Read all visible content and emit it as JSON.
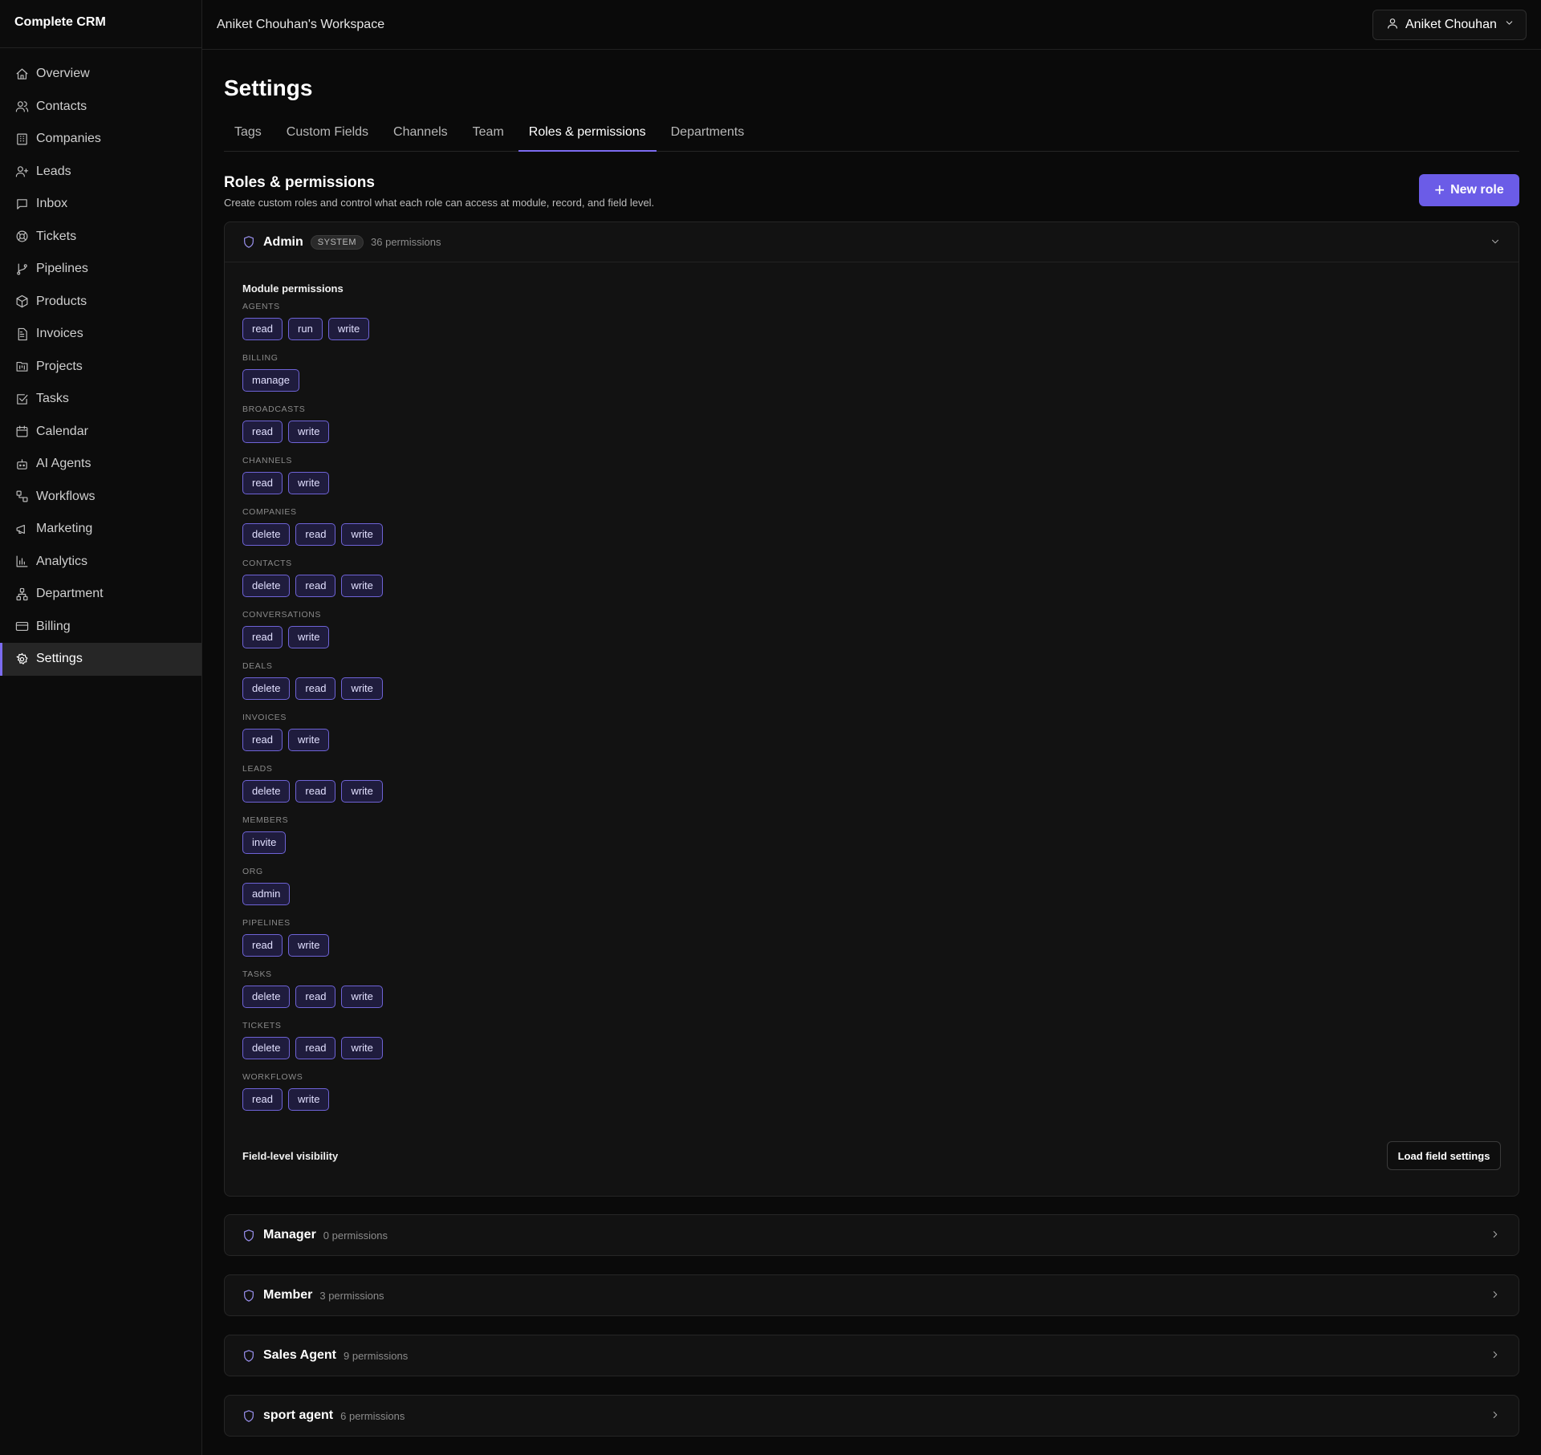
{
  "app": {
    "brand": "Complete CRM",
    "workspace": "Aniket Chouhan's Workspace",
    "user": "Aniket Chouhan"
  },
  "sidebar": {
    "items": [
      {
        "label": "Overview",
        "icon": "home-icon"
      },
      {
        "label": "Contacts",
        "icon": "users-icon"
      },
      {
        "label": "Companies",
        "icon": "building-icon"
      },
      {
        "label": "Leads",
        "icon": "user-plus-icon"
      },
      {
        "label": "Inbox",
        "icon": "message-icon"
      },
      {
        "label": "Tickets",
        "icon": "lifebuoy-icon"
      },
      {
        "label": "Pipelines",
        "icon": "git-branch-icon"
      },
      {
        "label": "Products",
        "icon": "package-icon"
      },
      {
        "label": "Invoices",
        "icon": "file-text-icon"
      },
      {
        "label": "Projects",
        "icon": "folder-kanban-icon"
      },
      {
        "label": "Tasks",
        "icon": "check-square-icon"
      },
      {
        "label": "Calendar",
        "icon": "calendar-icon"
      },
      {
        "label": "AI Agents",
        "icon": "bot-icon"
      },
      {
        "label": "Workflows",
        "icon": "workflow-icon"
      },
      {
        "label": "Marketing",
        "icon": "megaphone-icon"
      },
      {
        "label": "Analytics",
        "icon": "bar-chart-icon"
      },
      {
        "label": "Department",
        "icon": "network-icon"
      },
      {
        "label": "Billing",
        "icon": "credit-card-icon"
      },
      {
        "label": "Settings",
        "icon": "gear-icon",
        "active": true
      }
    ]
  },
  "page": {
    "title": "Settings"
  },
  "tabs": [
    {
      "label": "Tags"
    },
    {
      "label": "Custom Fields"
    },
    {
      "label": "Channels"
    },
    {
      "label": "Team"
    },
    {
      "label": "Roles & permissions",
      "active": true
    },
    {
      "label": "Departments"
    }
  ],
  "section": {
    "title": "Roles & permissions",
    "subtitle": "Create custom roles and control what each role can access at module, record, and field level.",
    "new_role_label": "New role"
  },
  "admin": {
    "name": "Admin",
    "badge": "SYSTEM",
    "count": "36 permissions",
    "module_title": "Module permissions",
    "modules": [
      {
        "name": "AGENTS",
        "perms": [
          "read",
          "run",
          "write"
        ]
      },
      {
        "name": "BILLING",
        "perms": [
          "manage"
        ]
      },
      {
        "name": "BROADCASTS",
        "perms": [
          "read",
          "write"
        ]
      },
      {
        "name": "CHANNELS",
        "perms": [
          "read",
          "write"
        ]
      },
      {
        "name": "COMPANIES",
        "perms": [
          "delete",
          "read",
          "write"
        ]
      },
      {
        "name": "CONTACTS",
        "perms": [
          "delete",
          "read",
          "write"
        ]
      },
      {
        "name": "CONVERSATIONS",
        "perms": [
          "read",
          "write"
        ]
      },
      {
        "name": "DEALS",
        "perms": [
          "delete",
          "read",
          "write"
        ]
      },
      {
        "name": "INVOICES",
        "perms": [
          "read",
          "write"
        ]
      },
      {
        "name": "LEADS",
        "perms": [
          "delete",
          "read",
          "write"
        ]
      },
      {
        "name": "MEMBERS",
        "perms": [
          "invite"
        ]
      },
      {
        "name": "ORG",
        "perms": [
          "admin"
        ]
      },
      {
        "name": "PIPELINES",
        "perms": [
          "read",
          "write"
        ]
      },
      {
        "name": "TASKS",
        "perms": [
          "delete",
          "read",
          "write"
        ]
      },
      {
        "name": "TICKETS",
        "perms": [
          "delete",
          "read",
          "write"
        ]
      },
      {
        "name": "WORKFLOWS",
        "perms": [
          "read",
          "write"
        ]
      }
    ],
    "field_title": "Field-level visibility",
    "load_label": "Load field settings"
  },
  "roles": [
    {
      "name": "Manager",
      "count": "0 permissions"
    },
    {
      "name": "Member",
      "count": "3 permissions"
    },
    {
      "name": "Sales Agent",
      "count": "9 permissions"
    },
    {
      "name": "sport agent",
      "count": "6 permissions"
    }
  ],
  "colors": {
    "accent": "#6b5ce7",
    "chip_border": "#6e63d6",
    "chip_bg": "#1f1c3d",
    "background": "#0a0a0a"
  }
}
